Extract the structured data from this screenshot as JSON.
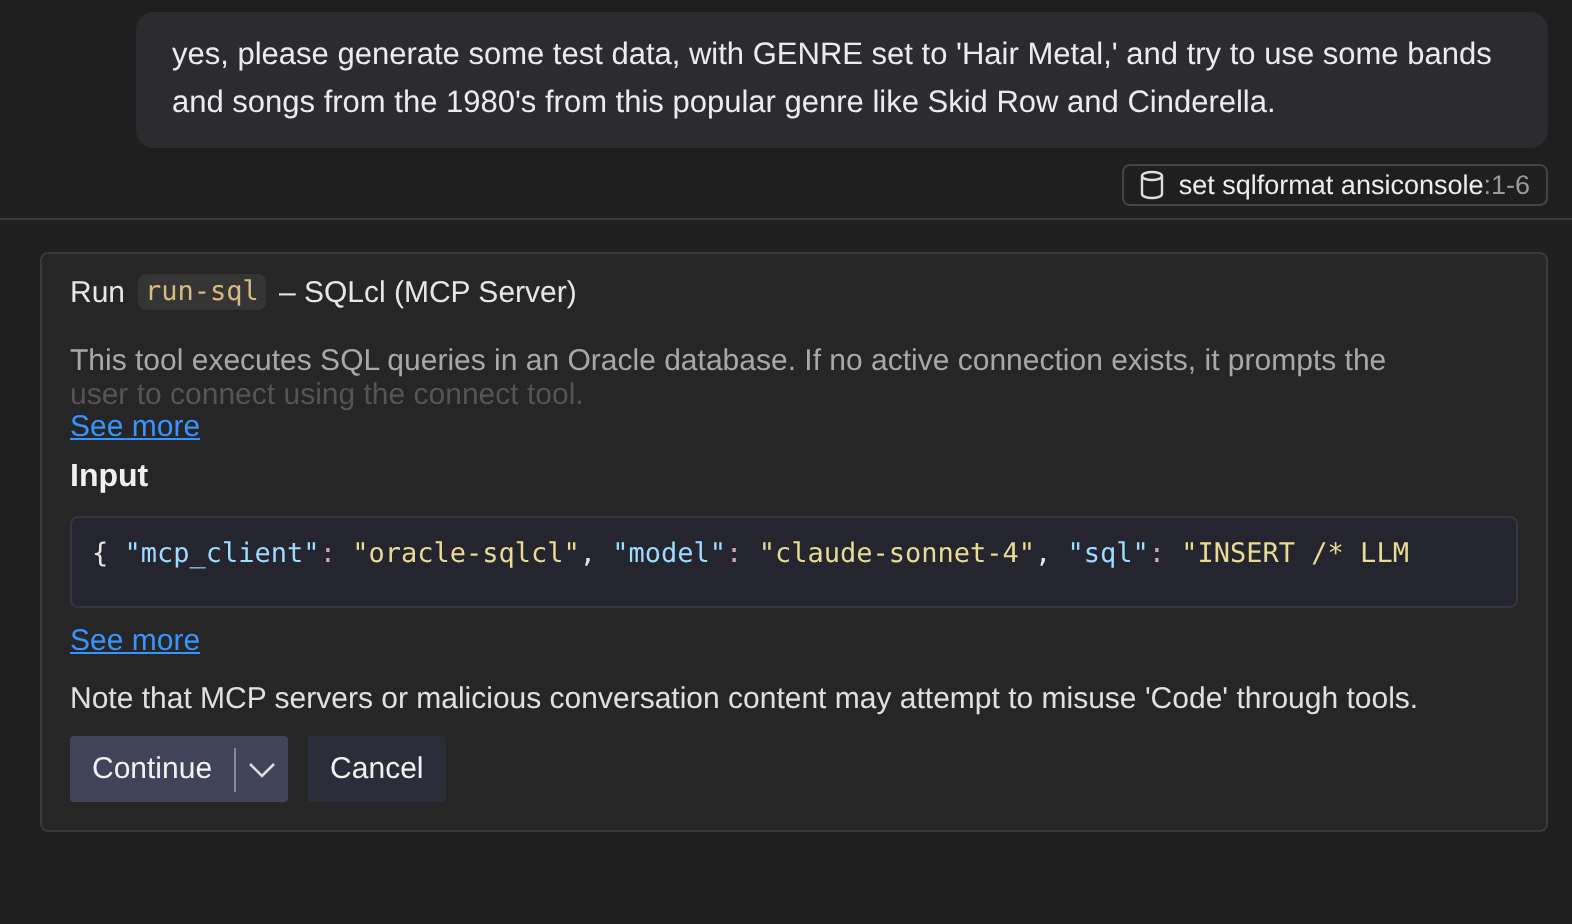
{
  "user_message": "yes, please generate some test data, with GENRE set to 'Hair Metal,' and try to use some bands and songs from the 1980's from this popular genre like Skid Row and Cinderella.",
  "reference_chip": {
    "label": "set sqlformat ansiconsole",
    "range": ":1-6"
  },
  "tool_dialog": {
    "title_prefix": "Run",
    "tool_name": "run-sql",
    "title_suffix": "– SQLcl (MCP Server)",
    "description": "This tool executes SQL queries in an Oracle database. If no active connection exists, it prompts the",
    "description_faded": "user to connect using the connect tool.",
    "see_more_description": "See more",
    "input_heading": "Input",
    "input_tokens": [
      {
        "kind": "punct",
        "text": "{ "
      },
      {
        "kind": "key",
        "text": "\"mcp_client\""
      },
      {
        "kind": "colon",
        "text": ": "
      },
      {
        "kind": "string",
        "text": "\"oracle-sqlcl\""
      },
      {
        "kind": "punct",
        "text": ", "
      },
      {
        "kind": "key",
        "text": "\"model\""
      },
      {
        "kind": "colon",
        "text": ": "
      },
      {
        "kind": "string",
        "text": "\"claude-sonnet-4\""
      },
      {
        "kind": "punct",
        "text": ", "
      },
      {
        "kind": "key",
        "text": "\"sql\""
      },
      {
        "kind": "colon",
        "text": ": "
      },
      {
        "kind": "string",
        "text": "\"INSERT /* LLM"
      }
    ],
    "see_more_input": "See more",
    "warning": "Note that MCP servers or malicious conversation content may attempt to misuse 'Code' through tools.",
    "buttons": [
      {
        "label": "Continue",
        "kind": "primary"
      },
      {
        "label": "Cancel",
        "kind": "secondary"
      }
    ]
  }
}
